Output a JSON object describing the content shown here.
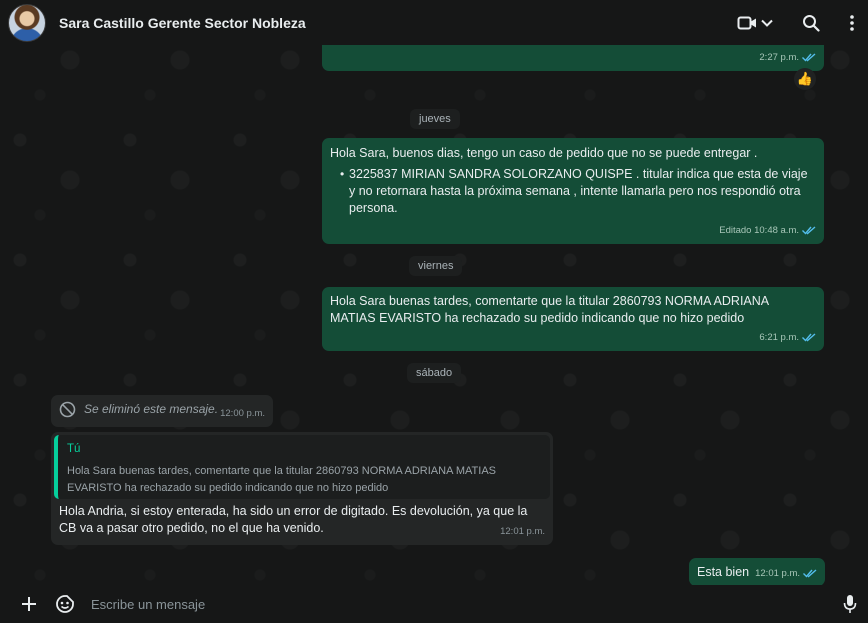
{
  "header": {
    "contact_name": "Sara Castillo Gerente Sector Nobleza"
  },
  "icons": {
    "video": "video-call-icon",
    "chevron": "chevron-down-icon",
    "search": "search-icon",
    "menu": "kebab-menu-icon",
    "plus": "plus-icon",
    "emoji": "emoji-icon",
    "mic": "microphone-icon",
    "deleted": "blocked-icon",
    "ticks": "double-check-icon"
  },
  "colors": {
    "outgoing_bubble": "#144d37",
    "incoming_bubble": "#242626",
    "read_ticks": "#53bdeb",
    "quote_accent": "#06cf9c"
  },
  "messages": {
    "m0": {
      "time": "2:27 p.m.",
      "reaction": "👍"
    },
    "day1": "jueves",
    "m1": {
      "text": "Hola Sara, buenos dias, tengo un caso de pedido que no se puede entregar .",
      "bullet": "3225837 MIRIAN SANDRA SOLORZANO QUISPE . titular indica que esta de viaje y no retornara hasta la próxima semana , intente llamarla pero nos respondió otra persona.",
      "time": "Editado 10:48 a.m."
    },
    "day2": "viernes",
    "m2": {
      "text": "Hola Sara buenas tardes, comentarte que la titular 2860793 NORMA ADRIANA MATIAS EVARISTO ha rechazado su pedido indicando que no hizo pedido",
      "time": "6:21 p.m."
    },
    "day3": "sábado",
    "m3": {
      "text": "Se eliminó este mensaje.",
      "time": "12:00 p.m."
    },
    "m4": {
      "quote_author": "Tú",
      "quote_text": "Hola Sara buenas tardes, comentarte que la titular 2860793 NORMA ADRIANA  MATIAS EVARISTO ha rechazado su pedido indicando que no hizo pedido",
      "text": "Hola Andria, si estoy enterada, ha sido un error de digitado. Es devolución, ya que la CB va a pasar otro pedido, no el que ha venido.",
      "time": "12:01 p.m."
    },
    "m5": {
      "text": "Esta bien",
      "time": "12:01 p.m."
    }
  },
  "composer": {
    "placeholder": "Escribe un mensaje"
  }
}
